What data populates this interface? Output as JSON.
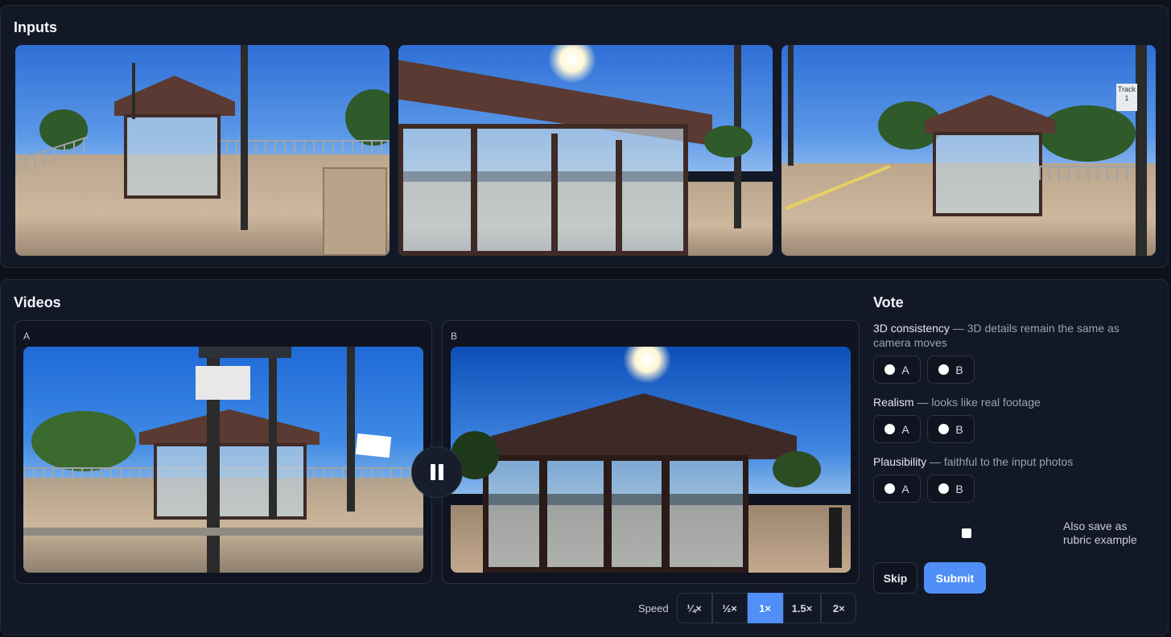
{
  "inputs": {
    "title": "Inputs",
    "photos": [
      {
        "name": "input-photo-1",
        "description": "train station platform shelter with trash bin"
      },
      {
        "name": "input-photo-2",
        "description": "close view of shelter with sun glare"
      },
      {
        "name": "input-photo-3",
        "description": "platform view toward shelter with track sign"
      }
    ],
    "photo3_sign": "Track 1"
  },
  "videos": {
    "title": "Videos",
    "a_label": "A",
    "b_label": "B",
    "speed_label": "Speed",
    "speeds": [
      "¼×",
      "½×",
      "1×",
      "1.5×",
      "2×"
    ],
    "active_speed": "1×"
  },
  "vote": {
    "title": "Vote",
    "criteria": [
      {
        "name": "3D consistency",
        "desc": " — 3D details remain the same as camera moves"
      },
      {
        "name": "Realism",
        "desc": " — looks like real footage"
      },
      {
        "name": "Plausibility",
        "desc": " — faithful to the input photos"
      }
    ],
    "option_a": "A",
    "option_b": "B",
    "rubric_label": "Also save as rubric example",
    "skip_label": "Skip",
    "submit_label": "Submit"
  },
  "colors": {
    "accent": "#4f8ff7",
    "background": "#0d1119",
    "panel": "#121826"
  }
}
